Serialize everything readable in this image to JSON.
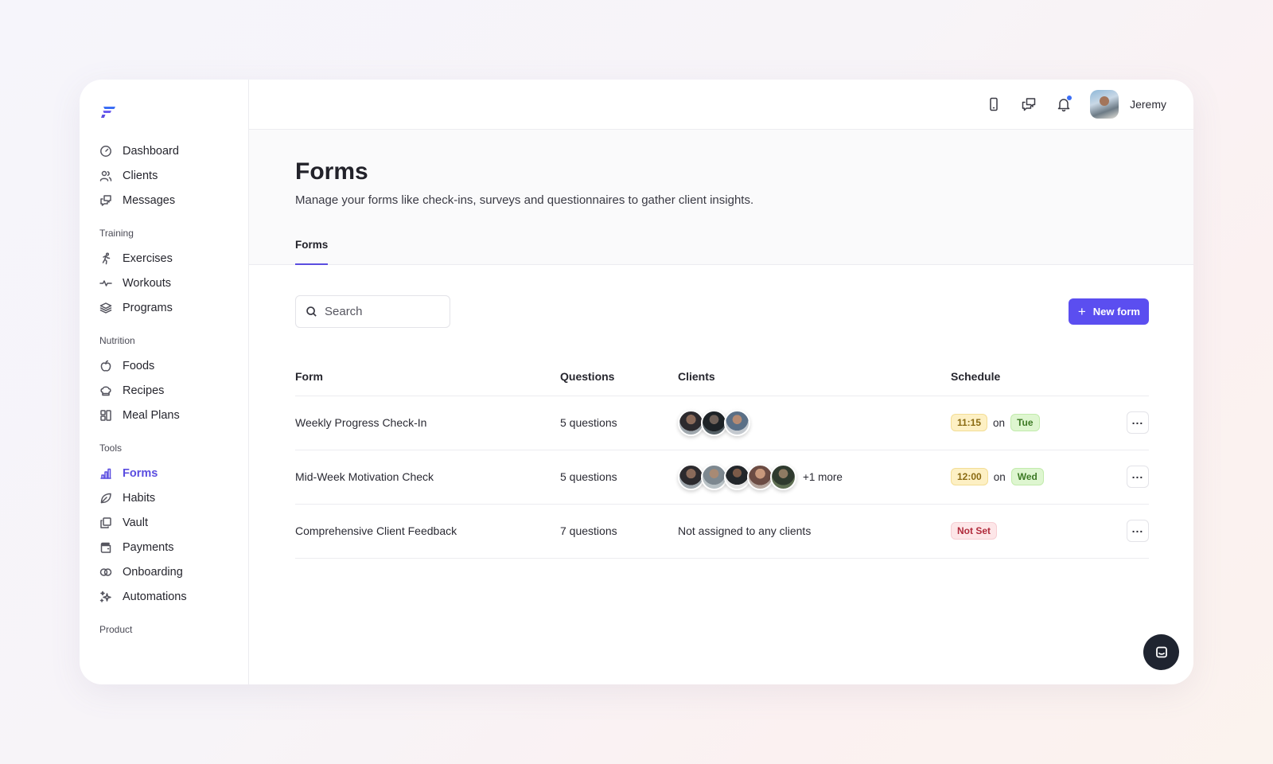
{
  "sidebar": {
    "main_items": [
      {
        "label": "Dashboard",
        "icon": "dashboard-icon"
      },
      {
        "label": "Clients",
        "icon": "clients-icon"
      },
      {
        "label": "Messages",
        "icon": "messages-icon"
      }
    ],
    "sections": {
      "training": "Training",
      "nutrition": "Nutrition",
      "tools": "Tools",
      "product": "Product"
    },
    "training_items": [
      {
        "label": "Exercises",
        "icon": "running-icon"
      },
      {
        "label": "Workouts",
        "icon": "pulse-icon"
      },
      {
        "label": "Programs",
        "icon": "layers-icon"
      }
    ],
    "nutrition_items": [
      {
        "label": "Foods",
        "icon": "apple-icon"
      },
      {
        "label": "Recipes",
        "icon": "chef-hat-icon"
      },
      {
        "label": "Meal Plans",
        "icon": "meal-plan-icon"
      }
    ],
    "tools_items": [
      {
        "label": "Forms",
        "icon": "forms-icon",
        "active": true
      },
      {
        "label": "Habits",
        "icon": "leaf-icon"
      },
      {
        "label": "Vault",
        "icon": "vault-icon"
      },
      {
        "label": "Payments",
        "icon": "wallet-icon"
      },
      {
        "label": "Onboarding",
        "icon": "onboarding-icon"
      },
      {
        "label": "Automations",
        "icon": "sparkles-icon"
      }
    ]
  },
  "topbar": {
    "user_name": "Jeremy"
  },
  "header": {
    "title": "Forms",
    "subtitle": "Manage your forms like check-ins, surveys and questionnaires to gather client insights.",
    "tab": "Forms"
  },
  "toolbar": {
    "search_placeholder": "Search",
    "new_button": "New form"
  },
  "table": {
    "headers": {
      "form": "Form",
      "questions": "Questions",
      "clients": "Clients",
      "schedule": "Schedule"
    },
    "rows": [
      {
        "form": "Weekly Progress Check-In",
        "questions": "5 questions",
        "time": "11:15",
        "on": "on",
        "day": "Tue"
      },
      {
        "form": "Mid-Week Motivation Check",
        "questions": "5 questions",
        "more": "+1 more",
        "time": "12:00",
        "on": "on",
        "day": "Wed"
      },
      {
        "form": "Comprehensive Client Feedback",
        "questions": "7 questions",
        "clients_text": "Not assigned to any clients",
        "status": "Not Set"
      }
    ]
  },
  "colors": {
    "accent": "#5b4ef0",
    "time_pill": "#fdf0c4",
    "day_pill": "#def6d0",
    "notset_pill": "#fde6e8"
  }
}
